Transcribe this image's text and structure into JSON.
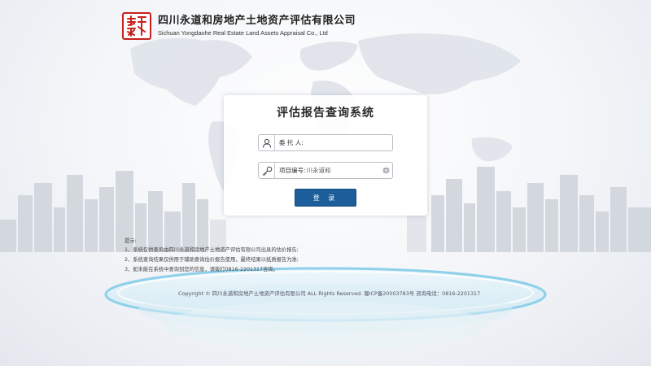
{
  "header": {
    "company_cn": "四川永道和房地产土地资产评估有限公司",
    "company_en": "Sichuan Yongdaohe Real Estate Land Assets Appraisal Co., Ltd",
    "logo_icon": "red-seal-logo"
  },
  "login": {
    "title": "评估报告查询系统",
    "client_label": "委 托 人:",
    "client_value": "",
    "project_label": "项目编号:",
    "project_placeholder": "川永道和",
    "button_label": "登 录"
  },
  "notes": {
    "title": "提示:",
    "items": [
      "1、系统仅供查询由四川永道和房地产土地资产评估有限公司出具的估价报告;",
      "2、系统查询结果仅供用于辅助查询估价报告使用，最终结果以纸质报告为准;",
      "3、如未能在系统中查询到您的信息，请拨打0816-2201317咨询。"
    ]
  },
  "footer": {
    "copyright": "Copyright © 四川永道和房地产土地资产评估有限公司 ALL Rights Reserved.   蜀ICP备20003783号   咨询电话：0816-2201317"
  },
  "colors": {
    "brand_red": "#c8201c",
    "button_blue": "#1b5e9a"
  }
}
